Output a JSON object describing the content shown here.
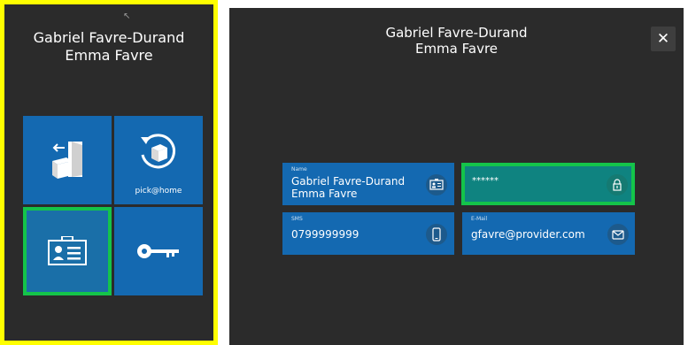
{
  "left": {
    "title_line1": "Gabriel Favre-Durand",
    "title_line2": "Emma Favre",
    "tiles": [
      {
        "icon": "logout-door-icon"
      },
      {
        "icon": "pick-at-home-icon",
        "label": "pick@home"
      },
      {
        "icon": "id-card-icon",
        "selected": true
      },
      {
        "icon": "key-icon"
      }
    ]
  },
  "right": {
    "title_line1": "Gabriel Favre-Durand",
    "title_line2": "Emma Favre",
    "close_label": "✕",
    "fields": {
      "name": {
        "label": "Name",
        "value_line1": "Gabriel Favre-Durand",
        "value_line2": "Emma Favre",
        "icon": "id-card-icon"
      },
      "password": {
        "value": "******",
        "icon": "lock-icon"
      },
      "sms": {
        "label": "SMS",
        "value": "0799999999",
        "icon": "phone-icon"
      },
      "email": {
        "label": "E-Mail",
        "value": "gfavre@provider.com",
        "icon": "mail-icon"
      }
    }
  },
  "colors": {
    "tile_blue": "#1469b1",
    "selected_green": "#14c44a",
    "highlight_yellow": "#ffff00",
    "panel_bg": "#2b2b2b"
  }
}
